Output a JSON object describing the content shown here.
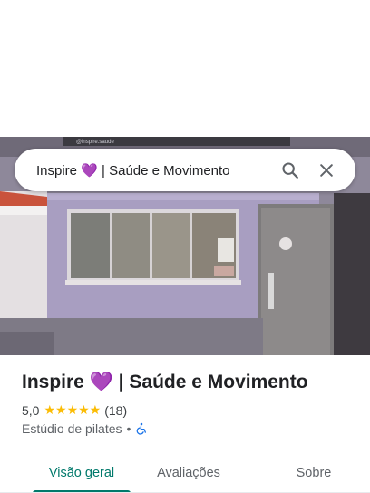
{
  "search": {
    "query": "Inspire 💜 | Saúde e Movimento",
    "search_icon": "search-icon",
    "close_icon": "close-icon"
  },
  "photo": {
    "sign_text": "@inspire.saude"
  },
  "place": {
    "title": "Inspire 💜 | Saúde e Movimento",
    "rating": "5,0",
    "stars": "★★★★★",
    "review_count": "(18)",
    "category": "Estúdio de pilates",
    "separator": "•",
    "accessibility_icon": "wheelchair-icon"
  },
  "tabs": [
    {
      "label": "Visão geral",
      "active": true
    },
    {
      "label": "Avaliações",
      "active": false
    },
    {
      "label": "Sobre",
      "active": false
    }
  ],
  "colors": {
    "accent": "#00796b",
    "star": "#fbbc04",
    "accessibility": "#1a73e8"
  }
}
